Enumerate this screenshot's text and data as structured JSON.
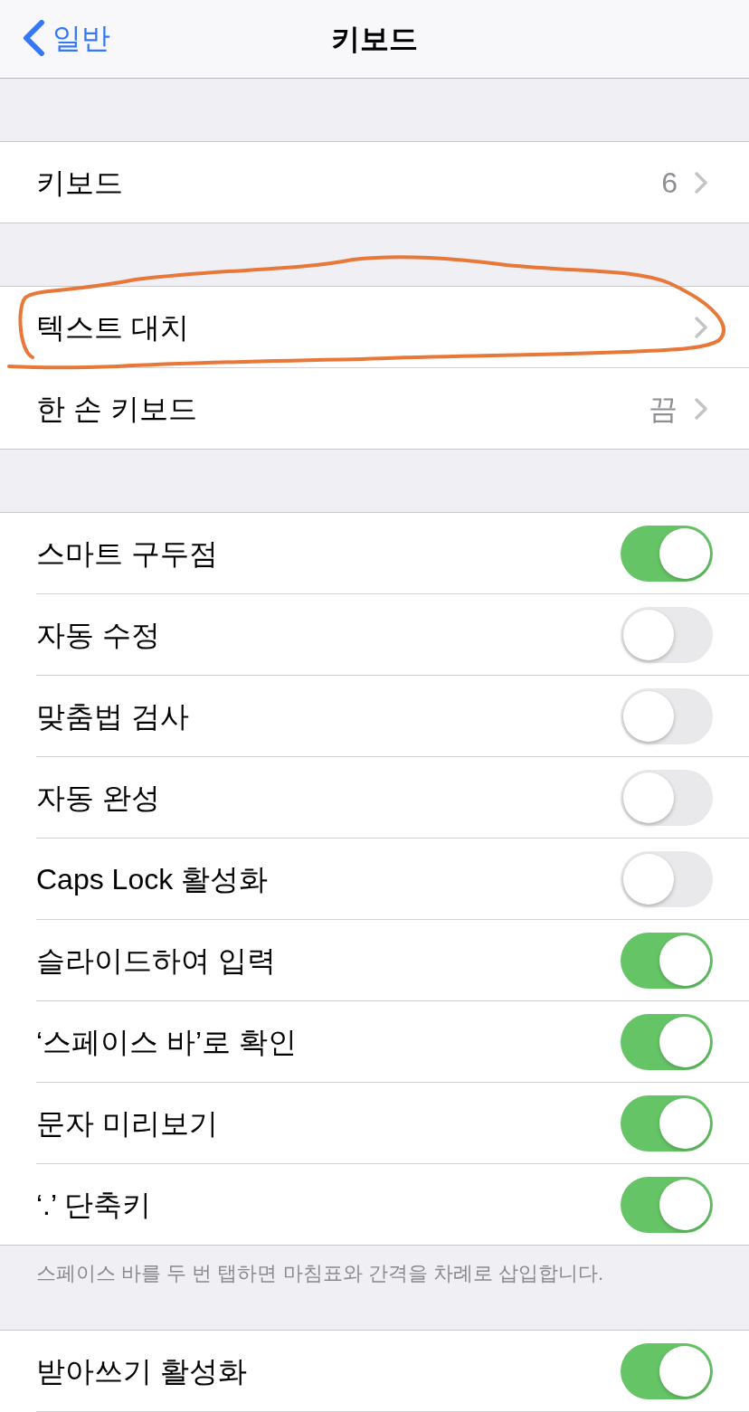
{
  "nav_bar": {
    "back_label": "일반",
    "title": "키보드"
  },
  "groups": [
    {
      "rows": [
        {
          "kind": "link",
          "label": "키보드",
          "value": "6",
          "circled": false
        }
      ]
    },
    {
      "rows": [
        {
          "kind": "link",
          "label": "텍스트 대치",
          "circled": true
        },
        {
          "kind": "link",
          "label": "한 손 키보드",
          "value": "끔",
          "circled": false
        }
      ]
    },
    {
      "rows": [
        {
          "kind": "toggle",
          "label": "스마트 구두점",
          "on": true,
          "circled": false
        },
        {
          "kind": "toggle",
          "label": "자동 수정",
          "on": false,
          "circled": false
        },
        {
          "kind": "toggle",
          "label": "맞춤법 검사",
          "on": false,
          "circled": false
        },
        {
          "kind": "toggle",
          "label": "자동 완성",
          "on": false,
          "circled": false
        },
        {
          "kind": "toggle",
          "label": "Caps Lock 활성화",
          "on": false,
          "circled": false
        },
        {
          "kind": "toggle",
          "label": "슬라이드하여 입력",
          "on": true,
          "circled": false
        },
        {
          "kind": "toggle",
          "label": "‘스페이스 바’로 확인",
          "on": true,
          "circled": false
        },
        {
          "kind": "toggle",
          "label": "문자 미리보기",
          "on": true,
          "circled": false
        },
        {
          "kind": "toggle",
          "label": "‘.’ 단축키",
          "on": true,
          "circled": false
        }
      ],
      "footer": "스페이스 바를 두 번 탭하면 마침표와 간격을 차례로 삽입합니다."
    },
    {
      "rows": [
        {
          "kind": "toggle",
          "label": "받아쓰기 활성화",
          "on": true,
          "circled": false
        }
      ]
    }
  ]
}
